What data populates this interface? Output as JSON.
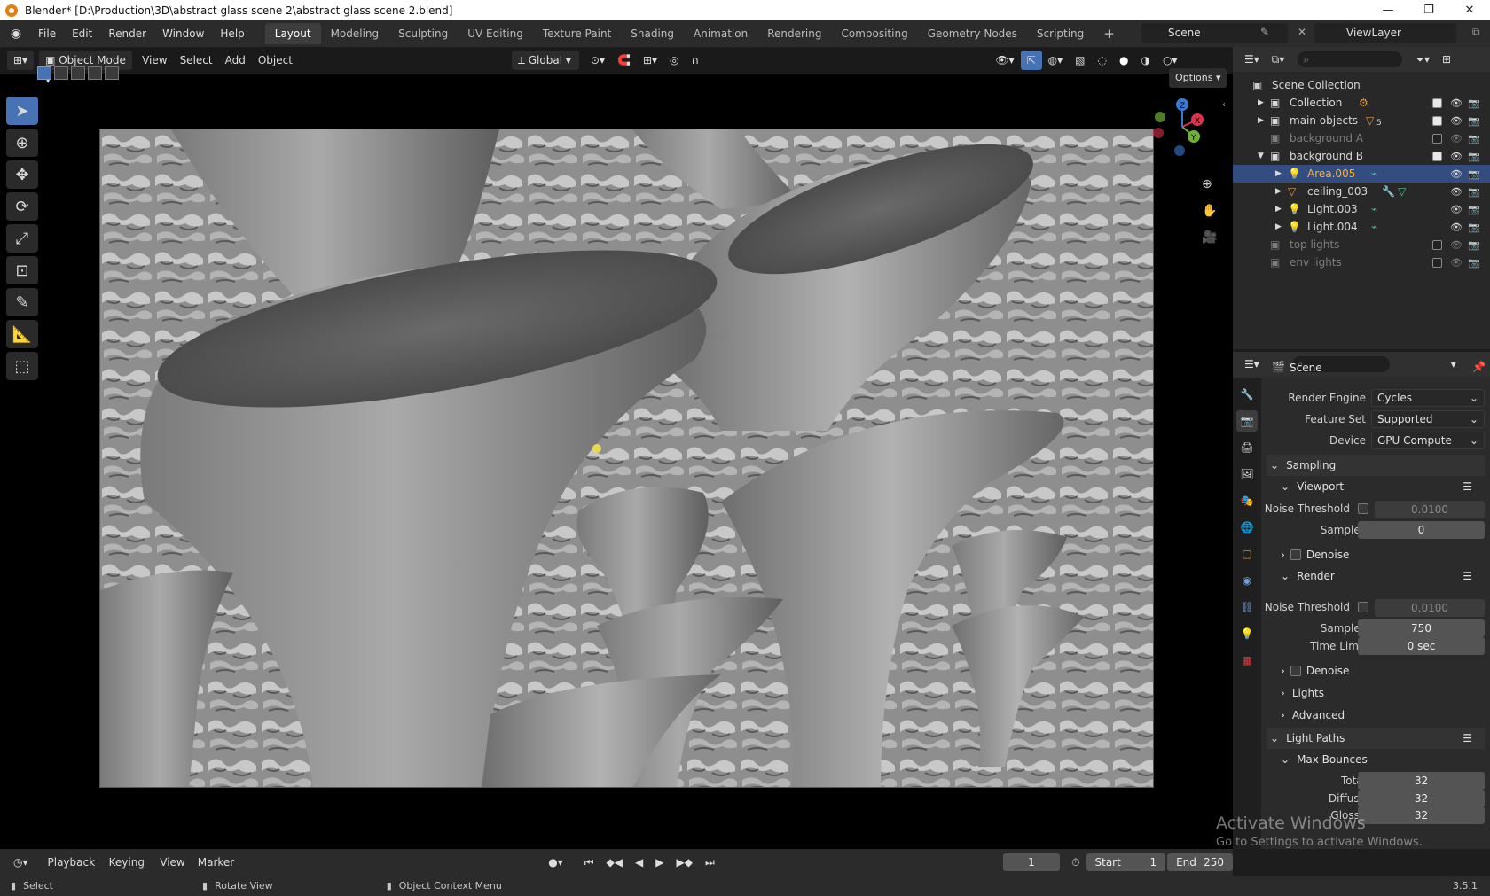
{
  "titlebar": {
    "title": "Blender* [D:\\Production\\3D\\abstract glass scene 2\\abstract glass scene 2.blend]",
    "minimize": "—",
    "maximize": "❐",
    "close": "✕"
  },
  "menu": [
    "File",
    "Edit",
    "Render",
    "Window",
    "Help"
  ],
  "workspaces": [
    "Layout",
    "Modeling",
    "Sculpting",
    "UV Editing",
    "Texture Paint",
    "Shading",
    "Animation",
    "Rendering",
    "Compositing",
    "Geometry Nodes",
    "Scripting"
  ],
  "workspace_add": "+",
  "scene_name": "Scene",
  "viewlayer_name": "ViewLayer",
  "viewport": {
    "mode": "Object Mode",
    "menus": [
      "View",
      "Select",
      "Add",
      "Object"
    ],
    "transform_orientation": "Global",
    "options_label": "Options"
  },
  "outliner": {
    "root": "Scene Collection",
    "rows": [
      {
        "label": "Collection",
        "level": 1,
        "expanded": false,
        "checked": true,
        "state": "normal"
      },
      {
        "label": "main objects",
        "level": 1,
        "expanded": false,
        "checked": true,
        "state": "normal",
        "badge": "5"
      },
      {
        "label": "background A",
        "level": 1,
        "expanded": false,
        "checked": false,
        "state": "dim"
      },
      {
        "label": "background B",
        "level": 1,
        "expanded": true,
        "checked": true,
        "state": "normal"
      },
      {
        "label": "Area.005",
        "level": 2,
        "expanded": false,
        "state": "selected"
      },
      {
        "label": "ceiling_003",
        "level": 2,
        "expanded": false,
        "state": "normal"
      },
      {
        "label": "Light.003",
        "level": 2,
        "expanded": false,
        "state": "normal"
      },
      {
        "label": "Light.004",
        "level": 2,
        "expanded": false,
        "state": "normal"
      },
      {
        "label": "top lights",
        "level": 1,
        "expanded": false,
        "checked": false,
        "state": "dim"
      },
      {
        "label": "env lights",
        "level": 1,
        "expanded": false,
        "checked": false,
        "state": "dim"
      }
    ]
  },
  "properties": {
    "context_title": "Scene",
    "render_engine_label": "Render Engine",
    "render_engine": "Cycles",
    "feature_set_label": "Feature Set",
    "feature_set": "Supported",
    "device_label": "Device",
    "device": "GPU Compute",
    "sampling": "Sampling",
    "viewport_section": "Viewport",
    "noise_threshold_label": "Noise Threshold",
    "viewport_noise_threshold": "0.0100",
    "samples_label": "Samples",
    "viewport_samples": "0",
    "denoise_label": "Denoise",
    "render_section": "Render",
    "render_noise_threshold": "0.0100",
    "render_samples": "750",
    "time_limit_label": "Time Limit",
    "time_limit": "0 sec",
    "lights_section": "Lights",
    "advanced_section": "Advanced",
    "light_paths_section": "Light Paths",
    "max_bounces_section": "Max Bounces",
    "total_label": "Total",
    "total": "32",
    "diffuse_label": "Diffuse",
    "diffuse": "32",
    "glossy_label": "Glossy",
    "glossy": "32"
  },
  "timeline": {
    "menus": [
      "Playback",
      "Keying",
      "View",
      "Marker"
    ],
    "current_frame": "1",
    "start_label": "Start",
    "start": "1",
    "end_label": "End",
    "end": "250"
  },
  "status": {
    "select": "Select",
    "rotate": "Rotate View",
    "context": "Object Context Menu",
    "version": "3.5.1"
  },
  "watermark": {
    "line1": "Activate Windows",
    "line2": "Go to Settings to activate Windows."
  },
  "colors": {
    "accent": "#4772b3",
    "selection": "#334d80",
    "active_object": "#ffaf29",
    "light_icon": "#e39b3e"
  }
}
